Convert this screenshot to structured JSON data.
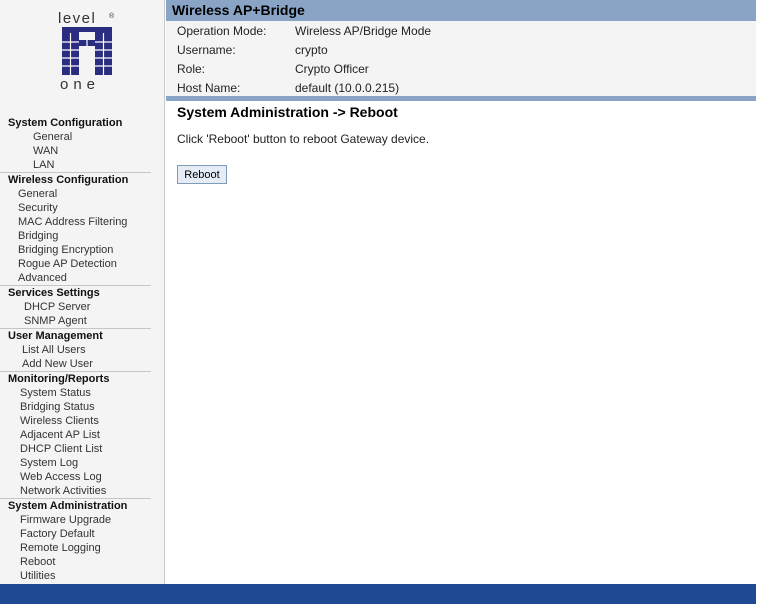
{
  "logo": {
    "top_text": "level",
    "bottom_text": "one",
    "mark": "®"
  },
  "nav": [
    {
      "title": "System Configuration",
      "indent": "i1",
      "items": [
        "General",
        "WAN",
        "LAN"
      ]
    },
    {
      "title": "Wireless Configuration",
      "indent": "i2",
      "items": [
        "General",
        "Security",
        "MAC Address Filtering",
        "Bridging",
        "Bridging Encryption",
        "Rogue AP Detection",
        "Advanced"
      ]
    },
    {
      "title": "Services Settings",
      "indent": "i3",
      "items": [
        "DHCP Server",
        "SNMP Agent"
      ]
    },
    {
      "title": "User Management",
      "indent": "i4",
      "items": [
        "List All Users",
        "Add New User"
      ]
    },
    {
      "title": "Monitoring/Reports",
      "indent": "i5",
      "items": [
        "System Status",
        "Bridging Status",
        "Wireless Clients",
        "Adjacent AP List",
        "DHCP Client List",
        "System Log",
        "Web Access Log",
        "Network Activities"
      ]
    },
    {
      "title": "System Administration",
      "indent": "i5",
      "items": [
        "Firmware Upgrade",
        "Factory Default",
        "Remote Logging",
        "Reboot",
        "Utilities"
      ]
    }
  ],
  "header": {
    "title": "Wireless AP+Bridge"
  },
  "info": {
    "rows": [
      {
        "label": "Operation Mode:",
        "value": "Wireless AP/Bridge Mode"
      },
      {
        "label": "Username:",
        "value": "crypto"
      },
      {
        "label": "Role:",
        "value": "Crypto Officer"
      },
      {
        "label": "Host Name:",
        "value": "default (10.0.0.215)"
      }
    ]
  },
  "main": {
    "title": "System Administration -> Reboot",
    "instruction": "Click 'Reboot' button to reboot Gateway device.",
    "button_label": "Reboot"
  },
  "colors": {
    "header_bar": "#8aa4c6",
    "footer_bar": "#1e4a94",
    "logo_blue": "#2a2d80"
  }
}
